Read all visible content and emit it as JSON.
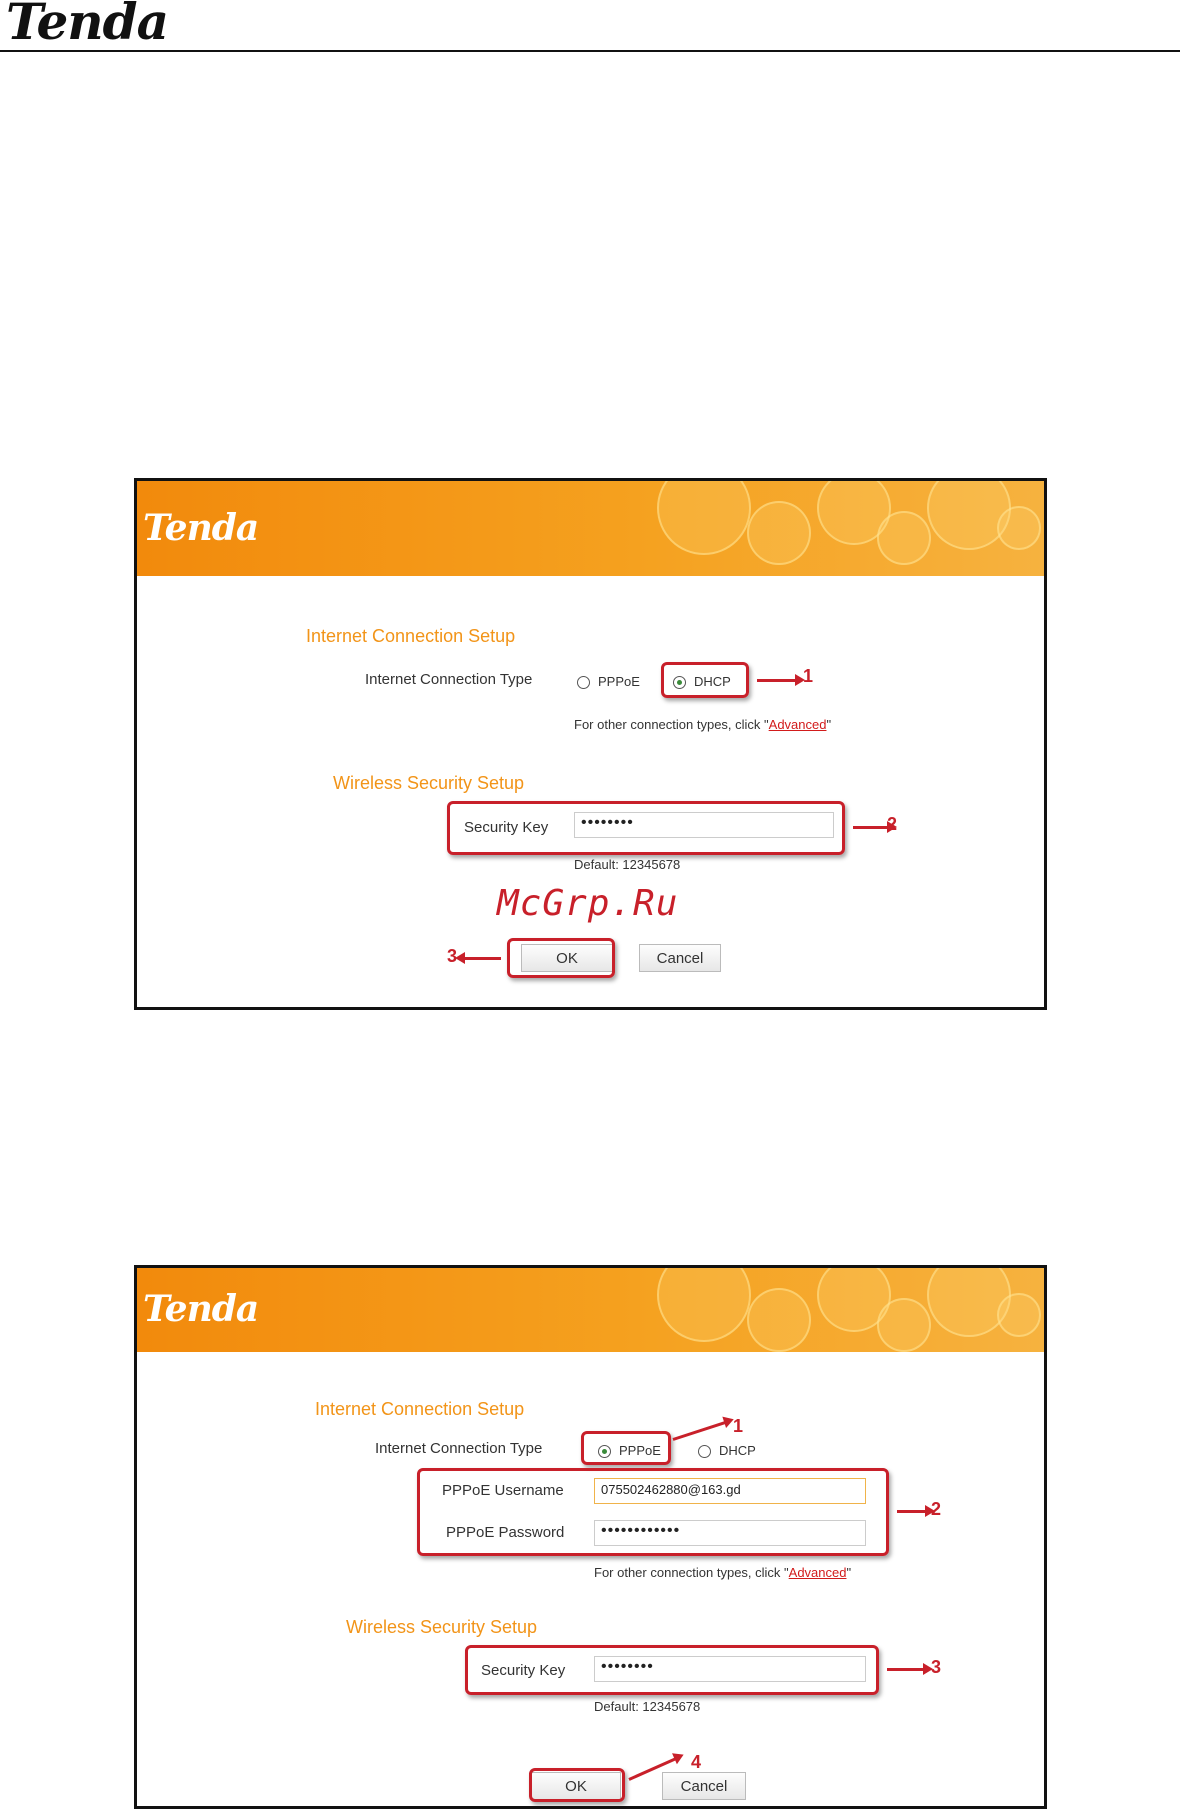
{
  "doc_header": {
    "logo": "Tenda"
  },
  "screenshot1": {
    "logo": "Tenda",
    "internet_section_title": "Internet Connection Setup",
    "connection_type_label": "Internet Connection Type",
    "options": {
      "pppoe": "PPPoE",
      "dhcp": "DHCP"
    },
    "selected_option": "DHCP",
    "hint_prefix": "For other connection types, click \"",
    "hint_link": "Advanced",
    "hint_suffix": "\"",
    "wireless_section_title": "Wireless Security Setup",
    "security_key_label": "Security Key",
    "security_key_value": "••••••••",
    "default_text": "Default: 12345678",
    "ok_label": "OK",
    "cancel_label": "Cancel",
    "callouts": [
      "1",
      "2",
      "3"
    ]
  },
  "watermark": "McGrp.Ru",
  "screenshot2": {
    "logo": "Tenda",
    "internet_section_title": "Internet Connection Setup",
    "connection_type_label": "Internet Connection Type",
    "options": {
      "pppoe": "PPPoE",
      "dhcp": "DHCP"
    },
    "selected_option": "PPPoE",
    "username_label": "PPPoE Username",
    "username_value": "075502462880@163.gd",
    "password_label": "PPPoE Password",
    "password_value": "••••••••••••",
    "hint_prefix": "For other connection types, click \"",
    "hint_link": "Advanced",
    "hint_suffix": "\"",
    "wireless_section_title": "Wireless Security Setup",
    "security_key_label": "Security Key",
    "security_key_value": "••••••••",
    "default_text": "Default: 12345678",
    "ok_label": "OK",
    "cancel_label": "Cancel",
    "callouts": [
      "1",
      "2",
      "3",
      "4"
    ]
  },
  "colors": {
    "accent_orange": "#f29418",
    "callout_red": "#c8202a",
    "link_red": "#d21b1b"
  }
}
